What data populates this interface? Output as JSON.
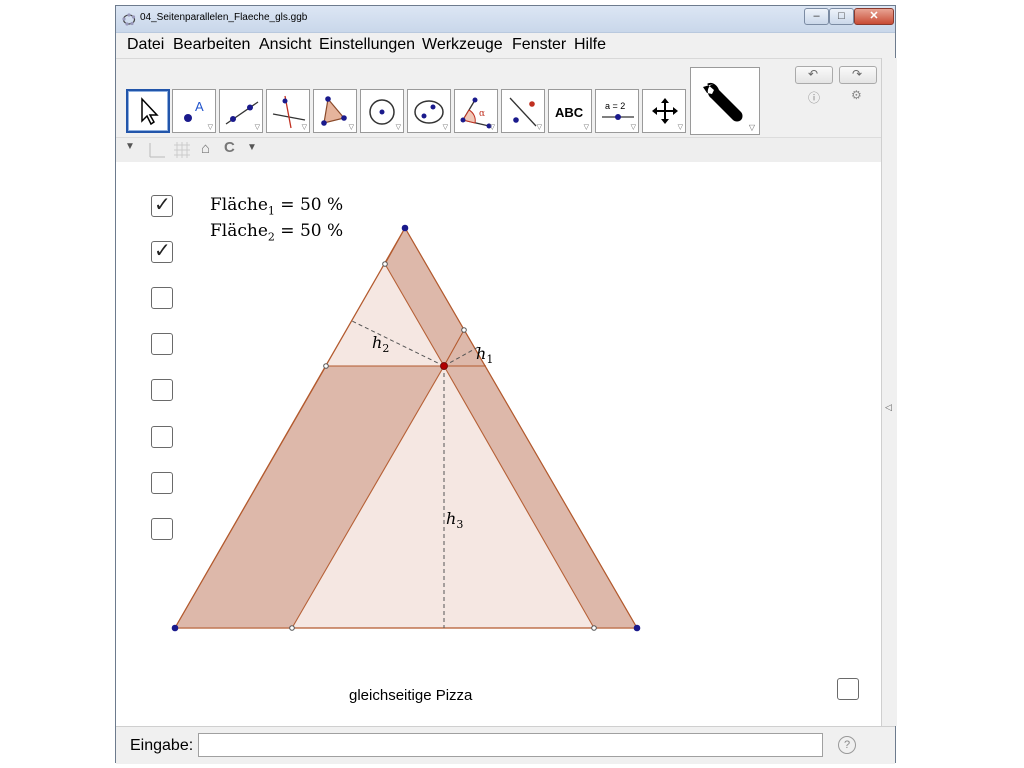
{
  "window": {
    "title": "04_Seitenparallelen_Flaeche_gls.ggb"
  },
  "menu": [
    "Datei",
    "Bearbeiten",
    "Ansicht",
    "Einstellungen",
    "Werkzeuge",
    "Fenster",
    "Hilfe"
  ],
  "toolbar": {
    "tools": [
      {
        "name": "move-tool",
        "icon": "arrow-pointer-icon"
      },
      {
        "name": "point-tool",
        "icon": "point-icon"
      },
      {
        "name": "line-tool",
        "icon": "line-icon"
      },
      {
        "name": "perpendicular-tool",
        "icon": "perpendicular-line-icon"
      },
      {
        "name": "polygon-tool",
        "icon": "polygon-icon"
      },
      {
        "name": "circle-tool",
        "icon": "circle-icon"
      },
      {
        "name": "ellipse-tool",
        "icon": "ellipse-icon"
      },
      {
        "name": "angle-tool",
        "icon": "angle-icon"
      },
      {
        "name": "reflect-tool",
        "icon": "reflect-icon"
      },
      {
        "name": "text-tool",
        "icon": "text-icon",
        "label": "ABC"
      },
      {
        "name": "slider-tool",
        "icon": "slider-icon",
        "label": "a = 2"
      },
      {
        "name": "move-view-tool",
        "icon": "move-view-icon"
      }
    ],
    "settings_icon": "wrench-icon"
  },
  "checkboxes": [
    {
      "checked": true
    },
    {
      "checked": true
    },
    {
      "checked": false
    },
    {
      "checked": false
    },
    {
      "checked": false
    },
    {
      "checked": false
    },
    {
      "checked": false
    },
    {
      "checked": false
    }
  ],
  "labels": {
    "flaeche1_name": "Fläche",
    "flaeche1_sub": "1",
    "flaeche1_value": " = 50 %",
    "flaeche2_name": "Fläche",
    "flaeche2_sub": "2",
    "flaeche2_value": " = 50 %",
    "h1": "h",
    "h1_sub": "1",
    "h2": "h",
    "h2_sub": "2",
    "h3": "h",
    "h3_sub": "3",
    "caption": "gleichseitige Pizza"
  },
  "input": {
    "label": "Eingabe:",
    "value": ""
  },
  "colors": {
    "fill_dark": "#d9b3a4",
    "fill_light": "#f3e4de",
    "stroke": "#b35a2e",
    "vertex": "#1a1a8c",
    "center": "#b00000"
  }
}
